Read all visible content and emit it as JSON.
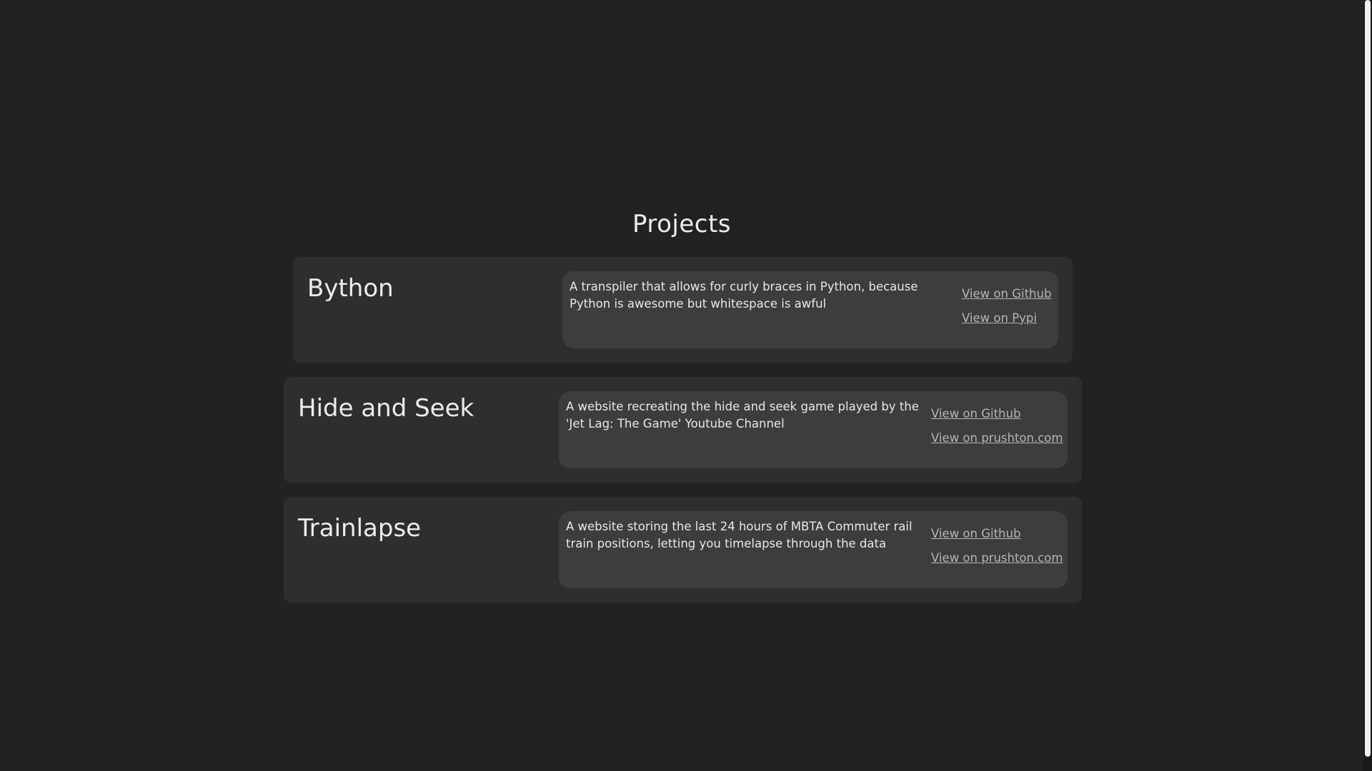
{
  "page": {
    "title": "Projects"
  },
  "projects": [
    {
      "name": "Bython",
      "description": "A transpiler that allows for curly braces in Python, because Python is awesome but whitespace is awful",
      "links": [
        "View on Github",
        "View on Pypi"
      ]
    },
    {
      "name": "Hide and Seek",
      "description": "A website recreating the hide and seek game played by the 'Jet Lag: The Game' Youtube Channel",
      "links": [
        "View on Github",
        "View on prushton.com"
      ]
    },
    {
      "name": "Trainlapse",
      "description": "A website storing the last 24 hours of MBTA Commuter rail train positions, letting you timelapse through the data",
      "links": [
        "View on Github",
        "View on prushton.com"
      ]
    }
  ],
  "colors": {
    "background": "#222222",
    "card": "#2e2e2e",
    "detail": "#3d3d3d",
    "link": "#b5b5b5"
  }
}
